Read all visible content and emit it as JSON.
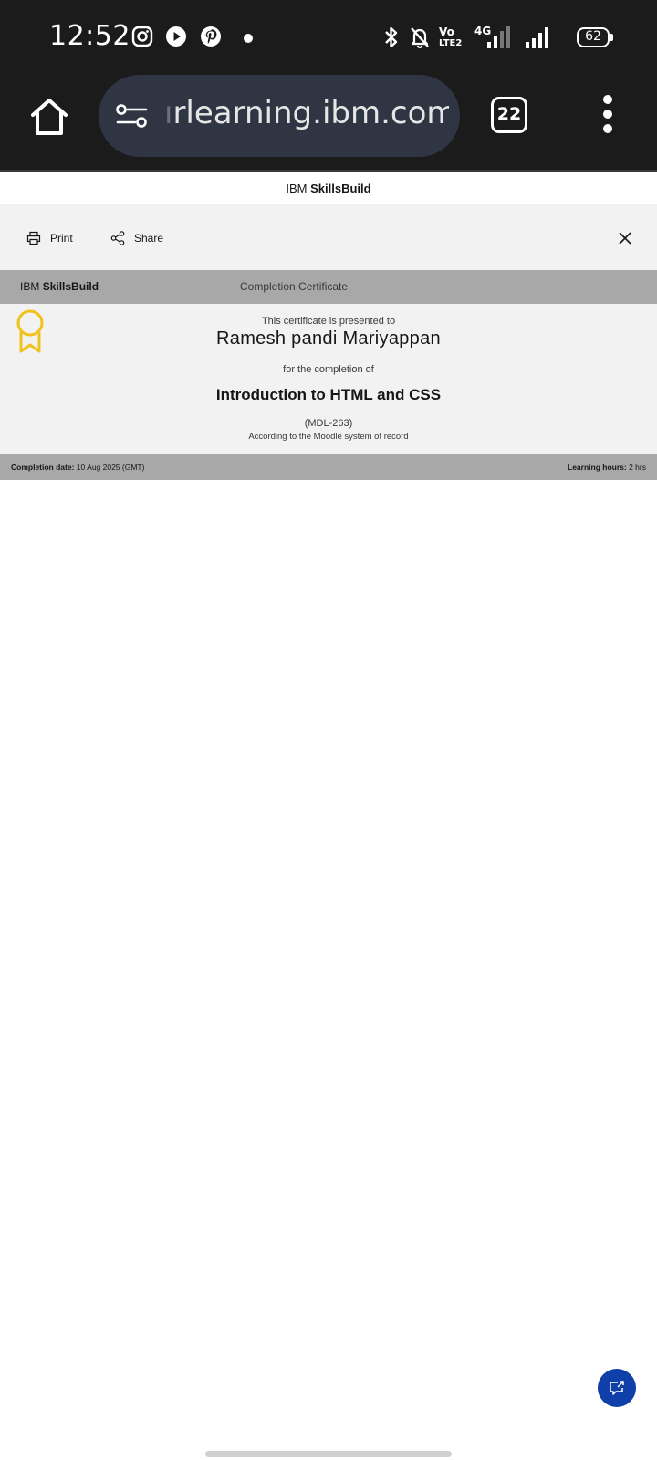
{
  "status_bar": {
    "time": "12:52",
    "notification_icons": [
      "instagram-icon",
      "youtube-icon",
      "pinterest-icon",
      "dot-icon"
    ],
    "system_icons": [
      "bluetooth-icon",
      "bell-off-icon",
      "volte-icon",
      "4g-signal-icon",
      "signal-icon"
    ],
    "volte_top": "Vo",
    "volte_bottom": "LTE2",
    "network": "4G",
    "battery": "62"
  },
  "browser": {
    "url_visible": "rlearning.ibm.com",
    "url_faded_prefix": "ı",
    "tab_count": "22"
  },
  "page": {
    "brand_prefix": "IBM",
    "brand_name": "SkillsBuild",
    "actions": {
      "print_label": "Print",
      "share_label": "Share"
    },
    "certificate": {
      "header_brand_prefix": "IBM",
      "header_brand_name": "SkillsBuild",
      "header_title": "Completion Certificate",
      "presented_text": "This certificate is presented to",
      "recipient": "Ramesh pandi Mariyappan",
      "completion_text": "for the completion of",
      "course": "Introduction to HTML and CSS",
      "course_code": "(MDL-263)",
      "record_text": "According to the Moodle system of record",
      "completion_date_label": "Completion date:",
      "completion_date": "10 Aug 2025 (GMT)",
      "learning_hours_label": "Learning hours:",
      "learning_hours": "2 hrs"
    }
  },
  "colors": {
    "status_bg": "#1b1b1b",
    "urlbar_bg": "#2f3543",
    "ribbon": "#f1c21b",
    "fab": "#0f3fa8",
    "gray_band": "#a8a8a8",
    "light_panel": "#f2f2f2"
  }
}
